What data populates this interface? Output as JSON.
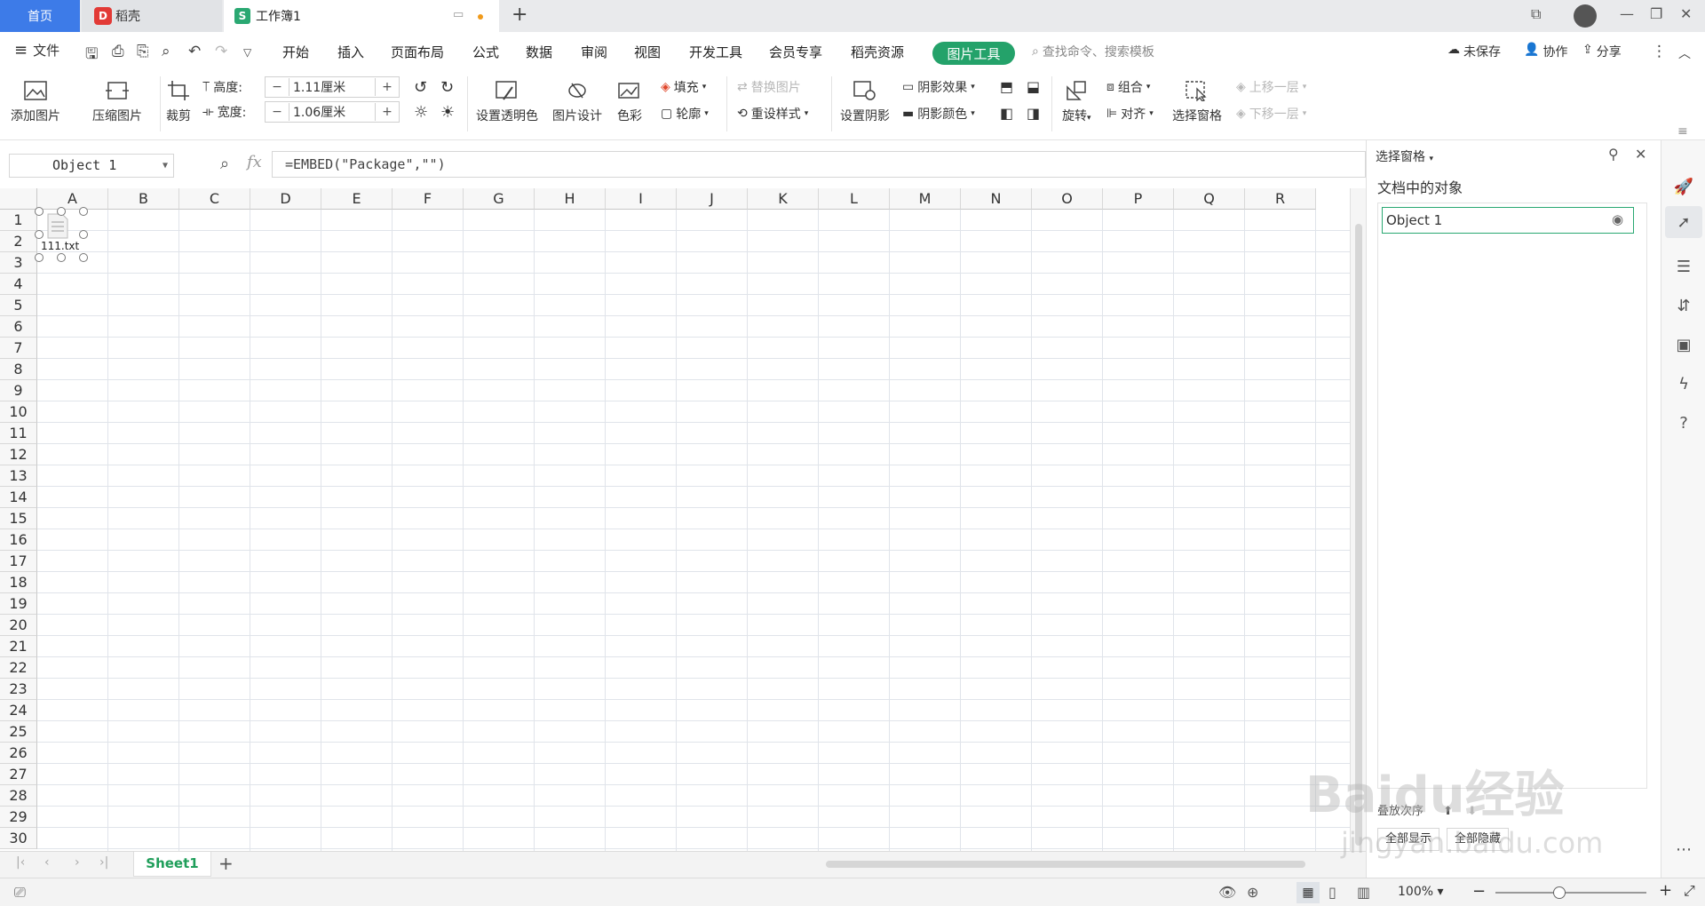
{
  "tabs": {
    "home": "首页",
    "daoke": "稻壳",
    "workbook": "工作簿1",
    "add": "+"
  },
  "menu": {
    "file": "文件",
    "items": [
      "开始",
      "插入",
      "页面布局",
      "公式",
      "数据",
      "审阅",
      "视图",
      "开发工具",
      "会员专享",
      "稻壳资源"
    ],
    "picture_tools": "图片工具",
    "search_placeholder": "查找命令、搜索模板",
    "unsaved": "未保存",
    "collab": "协作",
    "share": "分享"
  },
  "toolbar": {
    "add_picture": "添加图片",
    "compress_picture": "压缩图片",
    "crop": "裁剪",
    "height_label": "高度:",
    "height_value": "1.11厘米",
    "width_label": "宽度:",
    "width_value": "1.06厘米",
    "minus": "−",
    "plus": "+",
    "set_transparent": "设置透明色",
    "picture_design": "图片设计",
    "color": "色彩",
    "fill": "填充",
    "outline": "轮廓",
    "replace_picture": "替换图片",
    "reset_style": "重设样式",
    "set_shadow": "设置阴影",
    "shadow_effect": "阴影效果",
    "shadow_color": "阴影颜色",
    "rotate": "旋转",
    "group": "组合",
    "align": "对齐",
    "selection_pane": "选择窗格",
    "bring_forward": "上移一层",
    "send_backward": "下移一层"
  },
  "formula_bar": {
    "name_box": "Object 1",
    "fx": "fx",
    "formula": "=EMBED(\"Package\",\"\")"
  },
  "grid": {
    "columns": [
      "A",
      "B",
      "C",
      "D",
      "E",
      "F",
      "G",
      "H",
      "I",
      "J",
      "K",
      "L",
      "M",
      "N",
      "O",
      "P",
      "Q",
      "R"
    ],
    "rows": [
      "1",
      "2",
      "3",
      "4",
      "5",
      "6",
      "7",
      "8",
      "9",
      "10",
      "11",
      "12",
      "13",
      "14",
      "15",
      "16",
      "17",
      "18",
      "19",
      "20",
      "21",
      "22",
      "23",
      "24",
      "25",
      "26",
      "27",
      "28",
      "29",
      "30"
    ]
  },
  "embedded_object": {
    "label": "111.txt"
  },
  "sheets": {
    "active": "Sheet1",
    "add": "+"
  },
  "status": {
    "zoom": "100%"
  },
  "selection_pane": {
    "title": "选择窗格",
    "section": "文档中的对象",
    "objects": [
      "Object 1"
    ],
    "order_label": "叠放次序",
    "show_all": "全部显示",
    "hide_all": "全部隐藏"
  },
  "watermark": {
    "brand": "Baidu经验",
    "url": "jingyan.baidu.com"
  },
  "colors": {
    "accent_blue": "#3d7be8",
    "picture_tools_green": "#24a26a",
    "selected_object_border": "#2aa872"
  }
}
